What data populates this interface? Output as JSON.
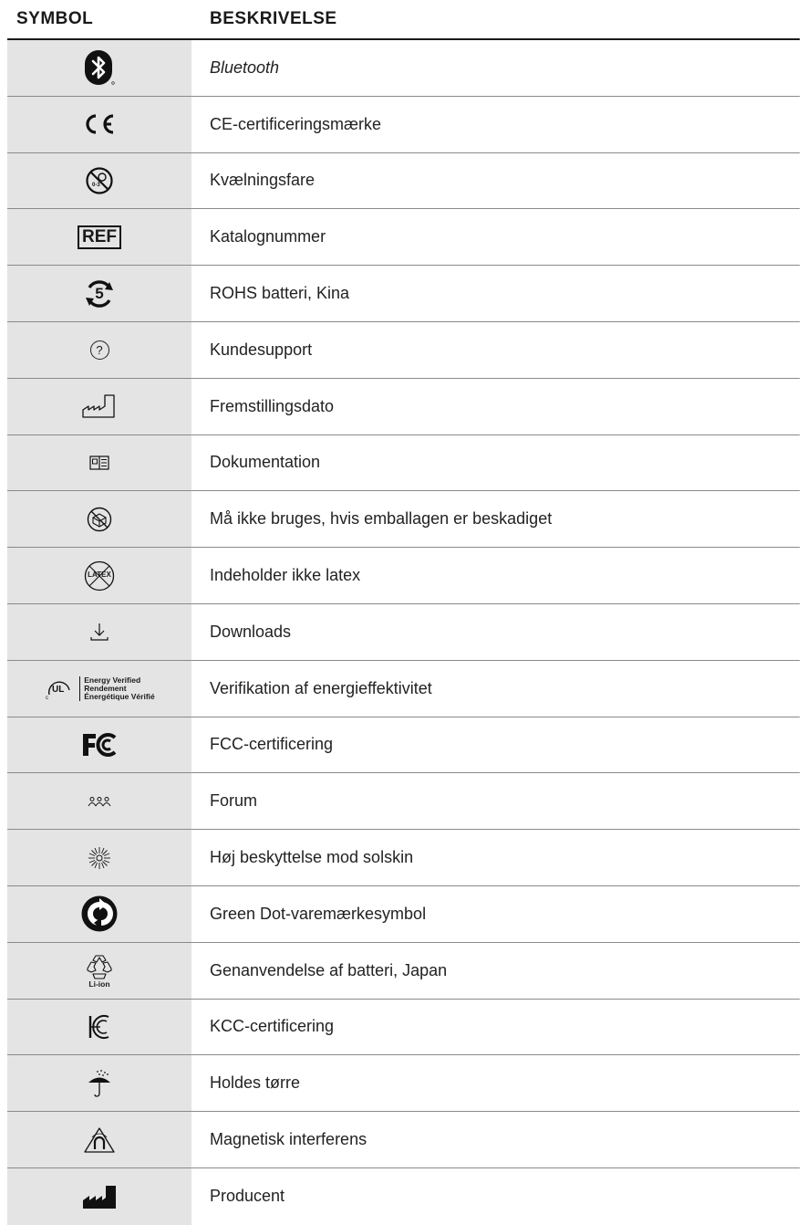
{
  "header": {
    "symbol": "SYMBOL",
    "description": "BESKRIVELSE"
  },
  "rows": [
    {
      "icon": "bluetooth-icon",
      "label": "Bluetooth"
    },
    {
      "icon": "ce-mark-icon",
      "label": "CE-certificeringsmærke"
    },
    {
      "icon": "choking-hazard-icon",
      "label": "Kvælningsfare"
    },
    {
      "icon": "ref-catalog-icon",
      "label": "Katalognummer",
      "icon_text": "REF"
    },
    {
      "icon": "rohs-china-icon",
      "label": "ROHS batteri, Kina",
      "icon_text": "5"
    },
    {
      "icon": "help-circle-icon",
      "label": "Kundesupport",
      "icon_text": "?"
    },
    {
      "icon": "manufacture-date-icon",
      "label": "Fremstillingsdato"
    },
    {
      "icon": "documentation-icon",
      "label": "Dokumentation"
    },
    {
      "icon": "damaged-package-icon",
      "label": "Må ikke bruges, hvis emballagen er beskadiget"
    },
    {
      "icon": "no-latex-icon",
      "label": "Indeholder ikke latex",
      "icon_text": "LATEX"
    },
    {
      "icon": "download-icon",
      "label": "Downloads"
    },
    {
      "icon": "ul-energy-verified-icon",
      "label": "Verifikation af energieffektivitet",
      "icon_lines": [
        "Energy Verified",
        "Rendement",
        "Énergétique Vérifié"
      ]
    },
    {
      "icon": "fcc-icon",
      "label": "FCC-certificering"
    },
    {
      "icon": "forum-people-icon",
      "label": "Forum"
    },
    {
      "icon": "sun-icon",
      "label": "Høj beskyttelse mod solskin"
    },
    {
      "icon": "green-dot-icon",
      "label": "Green Dot-varemærkesymbol"
    },
    {
      "icon": "recycle-li-ion-icon",
      "label": "Genanvendelse af batteri, Japan",
      "icon_text": "Li-ion"
    },
    {
      "icon": "kcc-icon",
      "label": "KCC-certificering"
    },
    {
      "icon": "keep-dry-umbrella-icon",
      "label": "Holdes tørre"
    },
    {
      "icon": "magnetic-interference-icon",
      "label": "Magnetisk interferens"
    },
    {
      "icon": "manufacturer-icon",
      "label": "Producent"
    }
  ]
}
